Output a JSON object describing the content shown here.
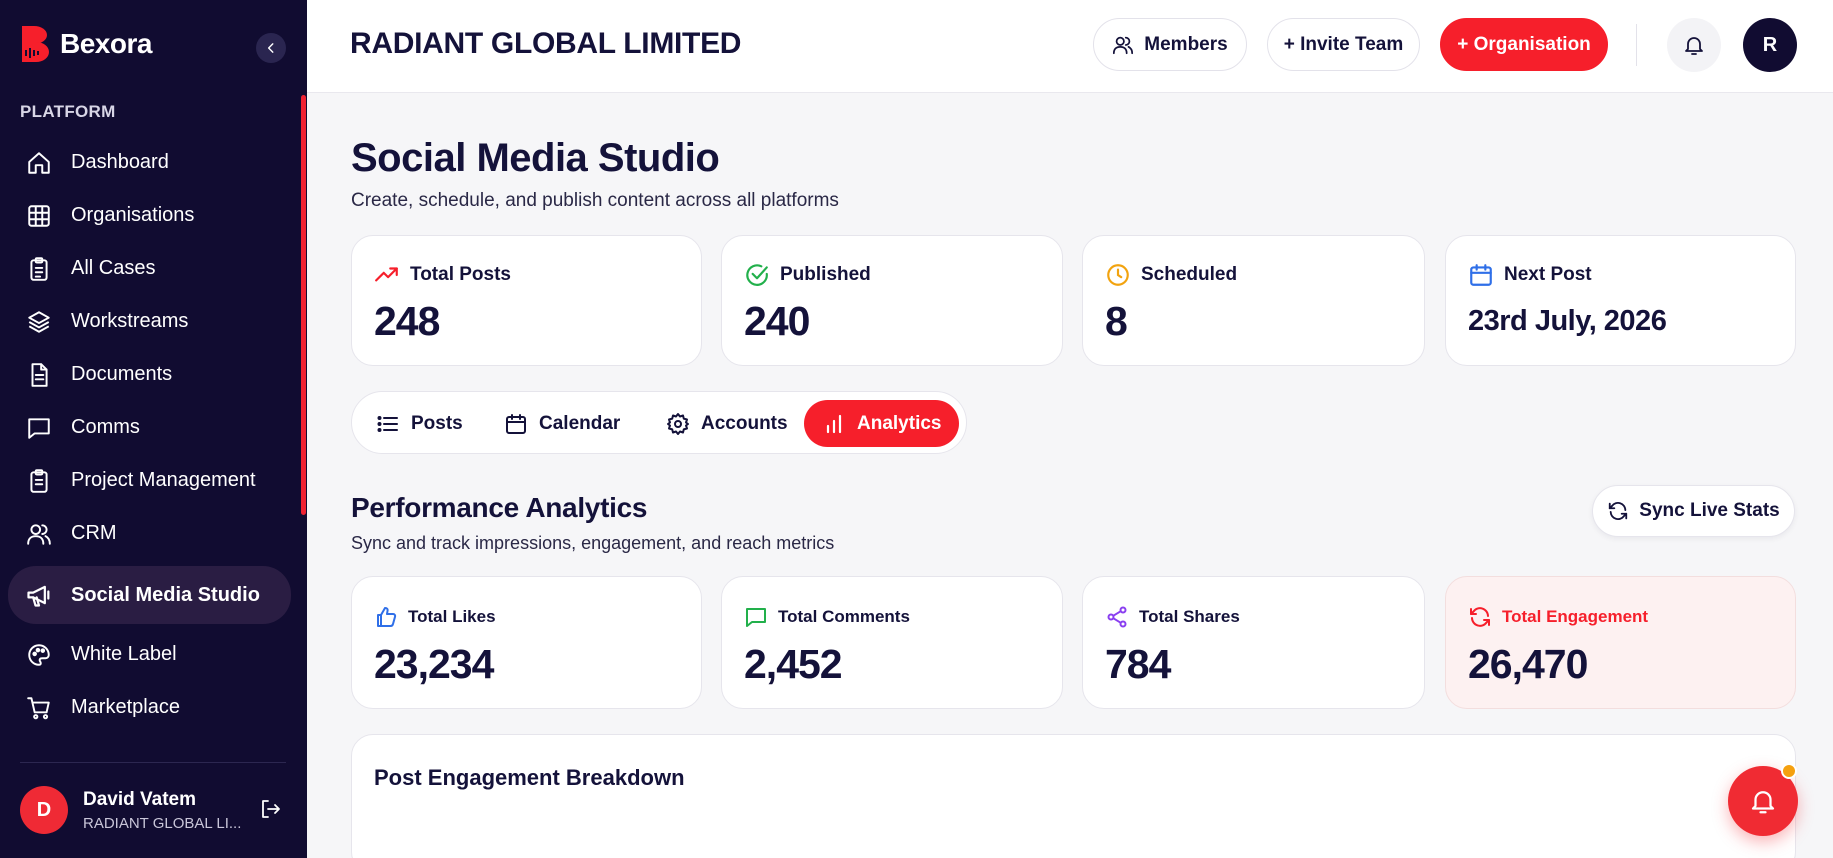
{
  "brand": {
    "name": "Bexora"
  },
  "sidebar": {
    "section": "PLATFORM",
    "items": [
      {
        "label": "Dashboard",
        "icon": "home-icon"
      },
      {
        "label": "Organisations",
        "icon": "grid-icon"
      },
      {
        "label": "All Cases",
        "icon": "clipboard-icon"
      },
      {
        "label": "Workstreams",
        "icon": "layers-icon"
      },
      {
        "label": "Documents",
        "icon": "document-icon"
      },
      {
        "label": "Comms",
        "icon": "chat-icon"
      },
      {
        "label": "Project Management",
        "icon": "clipboard-list-icon"
      },
      {
        "label": "CRM",
        "icon": "users-icon"
      },
      {
        "label": "Social Media Studio",
        "icon": "megaphone-icon",
        "active": true
      },
      {
        "label": "White Label",
        "icon": "palette-icon"
      },
      {
        "label": "Marketplace",
        "icon": "cart-icon"
      }
    ],
    "user": {
      "initial": "D",
      "name": "David Vatem",
      "org": "RADIANT GLOBAL LI..."
    }
  },
  "header": {
    "org_title": "RADIANT GLOBAL LIMITED",
    "members_label": "Members",
    "invite_label": "+ Invite Team",
    "organisation_label": "+ Organisation",
    "avatar_initial": "R"
  },
  "page": {
    "title": "Social Media Studio",
    "subtitle": "Create, schedule, and publish content across all platforms"
  },
  "stats": [
    {
      "label": "Total Posts",
      "value": "248",
      "icon": "trending-up-icon",
      "color": "#f61f2b"
    },
    {
      "label": "Published",
      "value": "240",
      "icon": "check-circle-icon",
      "color": "#22b04b"
    },
    {
      "label": "Scheduled",
      "value": "8",
      "icon": "clock-icon",
      "color": "#f2a30f"
    },
    {
      "label": "Next Post",
      "value": "23rd July, 2026",
      "icon": "calendar-icon",
      "color": "#2f6fe8"
    }
  ],
  "tabs": [
    {
      "label": "Posts",
      "icon": "list-icon"
    },
    {
      "label": "Calendar",
      "icon": "calendar-icon"
    },
    {
      "label": "Accounts",
      "icon": "gear-icon"
    },
    {
      "label": "Analytics",
      "icon": "bar-chart-icon",
      "active": true
    }
  ],
  "analytics": {
    "title": "Performance Analytics",
    "subtitle": "Sync and track impressions, engagement, and reach metrics",
    "sync_label": "Sync Live Stats",
    "metrics": [
      {
        "label": "Total Likes",
        "value": "23,234",
        "icon": "thumbs-up-icon",
        "color": "#2f6fe8"
      },
      {
        "label": "Total Comments",
        "value": "2,452",
        "icon": "message-icon",
        "color": "#22b04b"
      },
      {
        "label": "Total Shares",
        "value": "784",
        "icon": "share-icon",
        "color": "#8a3ff0"
      },
      {
        "label": "Total Engagement",
        "value": "26,470",
        "icon": "refresh-icon",
        "color": "#f61f2b"
      }
    ],
    "breakdown_title": "Post Engagement Breakdown"
  },
  "colors": {
    "accent": "#f61f2b",
    "sidebar": "#110c31",
    "notification_dot": "#f5a00f"
  }
}
